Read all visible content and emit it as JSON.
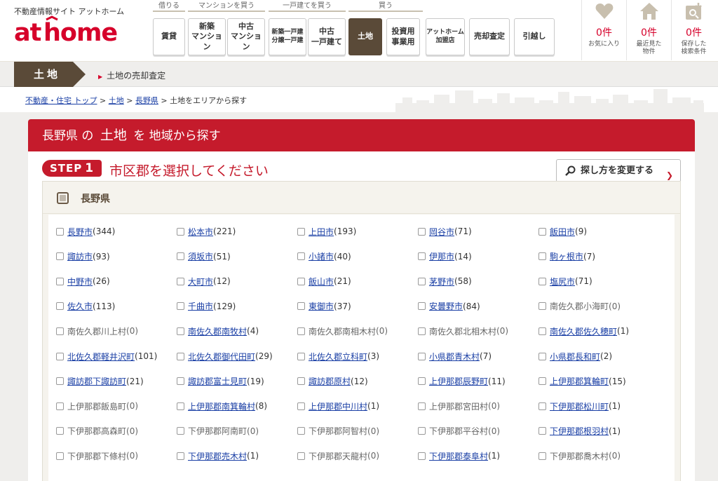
{
  "header": {
    "tagline": "不動産情報サイト アットホーム",
    "logo_text": "athome",
    "nav_groups": [
      {
        "label": "借りる",
        "buttons": [
          "賃貸"
        ]
      },
      {
        "label": "マンションを買う",
        "buttons": [
          "新築\nマンション",
          "中古\nマンション"
        ]
      },
      {
        "label": "一戸建てを買う",
        "buttons": [
          "新築一戸建\n分譲一戸建",
          "中古\n一戸建て"
        ]
      },
      {
        "label": "買う",
        "buttons": [
          "土地",
          "投資用\n事業用",
          "アットホーム\n加盟店",
          "売却査定",
          "引越し"
        ]
      }
    ],
    "active_button": "土地",
    "counters": [
      {
        "icon": "heart-icon",
        "count": "0件",
        "label": "お気に入り"
      },
      {
        "icon": "house-icon",
        "count": "0件",
        "label": "最近見た\n物件"
      },
      {
        "icon": "saved-search-icon",
        "count": "0件",
        "label": "保存した\n検索条件"
      }
    ]
  },
  "subbar": {
    "tab": "土地",
    "link": "土地の売却査定"
  },
  "breadcrumb": {
    "items": [
      "不動産・住宅 トップ",
      "土地",
      "長野県"
    ],
    "current": "土地をエリアから探す",
    "sep": " > "
  },
  "panel": {
    "title_pref": "長野県",
    "title_no": "の",
    "title_type": "土地",
    "title_wo": "を",
    "title_rest": "地域から探す",
    "step_label": "STEP",
    "step_num": "1",
    "step_text": "市区郡を選択してください",
    "change_button": "探し方を変更する"
  },
  "prefecture": {
    "name": "長野県"
  },
  "municipalities": [
    {
      "name": "長野市",
      "count": "(344)"
    },
    {
      "name": "松本市",
      "count": "(221)"
    },
    {
      "name": "上田市",
      "count": "(193)"
    },
    {
      "name": "岡谷市",
      "count": "(71)"
    },
    {
      "name": "飯田市",
      "count": "(9)"
    },
    {
      "name": "諏訪市",
      "count": "(93)"
    },
    {
      "name": "須坂市",
      "count": "(51)"
    },
    {
      "name": "小諸市",
      "count": "(40)"
    },
    {
      "name": "伊那市",
      "count": "(14)"
    },
    {
      "name": "駒ヶ根市",
      "count": "(7)"
    },
    {
      "name": "中野市",
      "count": "(26)"
    },
    {
      "name": "大町市",
      "count": "(12)"
    },
    {
      "name": "飯山市",
      "count": "(21)"
    },
    {
      "name": "茅野市",
      "count": "(58)"
    },
    {
      "name": "塩尻市",
      "count": "(71)"
    },
    {
      "name": "佐久市",
      "count": "(113)"
    },
    {
      "name": "千曲市",
      "count": "(129)"
    },
    {
      "name": "東御市",
      "count": "(37)"
    },
    {
      "name": "安曇野市",
      "count": "(84)"
    },
    {
      "name": "南佐久郡小海町",
      "count": "(0)"
    },
    {
      "name": "南佐久郡川上村",
      "count": "(0)"
    },
    {
      "name": "南佐久郡南牧村",
      "count": "(4)"
    },
    {
      "name": "南佐久郡南相木村",
      "count": "(0)"
    },
    {
      "name": "南佐久郡北相木村",
      "count": "(0)"
    },
    {
      "name": "南佐久郡佐久穂町",
      "count": "(1)"
    },
    {
      "name": "北佐久郡軽井沢町",
      "count": "(101)"
    },
    {
      "name": "北佐久郡御代田町",
      "count": "(29)"
    },
    {
      "name": "北佐久郡立科町",
      "count": "(3)"
    },
    {
      "name": "小県郡青木村",
      "count": "(7)"
    },
    {
      "name": "小県郡長和町",
      "count": "(2)"
    },
    {
      "name": "諏訪郡下諏訪町",
      "count": "(21)"
    },
    {
      "name": "諏訪郡富士見町",
      "count": "(19)"
    },
    {
      "name": "諏訪郡原村",
      "count": "(12)"
    },
    {
      "name": "上伊那郡辰野町",
      "count": "(11)"
    },
    {
      "name": "上伊那郡箕輪町",
      "count": "(15)"
    },
    {
      "name": "上伊那郡飯島町",
      "count": "(0)"
    },
    {
      "name": "上伊那郡南箕輪村",
      "count": "(8)"
    },
    {
      "name": "上伊那郡中川村",
      "count": "(1)"
    },
    {
      "name": "上伊那郡宮田村",
      "count": "(0)"
    },
    {
      "name": "下伊那郡松川町",
      "count": "(1)"
    },
    {
      "name": "下伊那郡高森町",
      "count": "(0)"
    },
    {
      "name": "下伊那郡阿南町",
      "count": "(0)"
    },
    {
      "name": "下伊那郡阿智村",
      "count": "(0)"
    },
    {
      "name": "下伊那郡平谷村",
      "count": "(0)"
    },
    {
      "name": "下伊那郡根羽村",
      "count": "(1)"
    },
    {
      "name": "下伊那郡下條村",
      "count": "(0)"
    },
    {
      "name": "下伊那郡売木村",
      "count": "(1)"
    },
    {
      "name": "下伊那郡天龍村",
      "count": "(0)"
    },
    {
      "name": "下伊那郡泰阜村",
      "count": "(1)"
    },
    {
      "name": "下伊那郡喬木村",
      "count": "(0)"
    }
  ],
  "colors": {
    "brand_red": "#c51b2c",
    "brown": "#5a4a38",
    "link_blue": "#1a3fa5",
    "counter_red": "#d6002a"
  }
}
